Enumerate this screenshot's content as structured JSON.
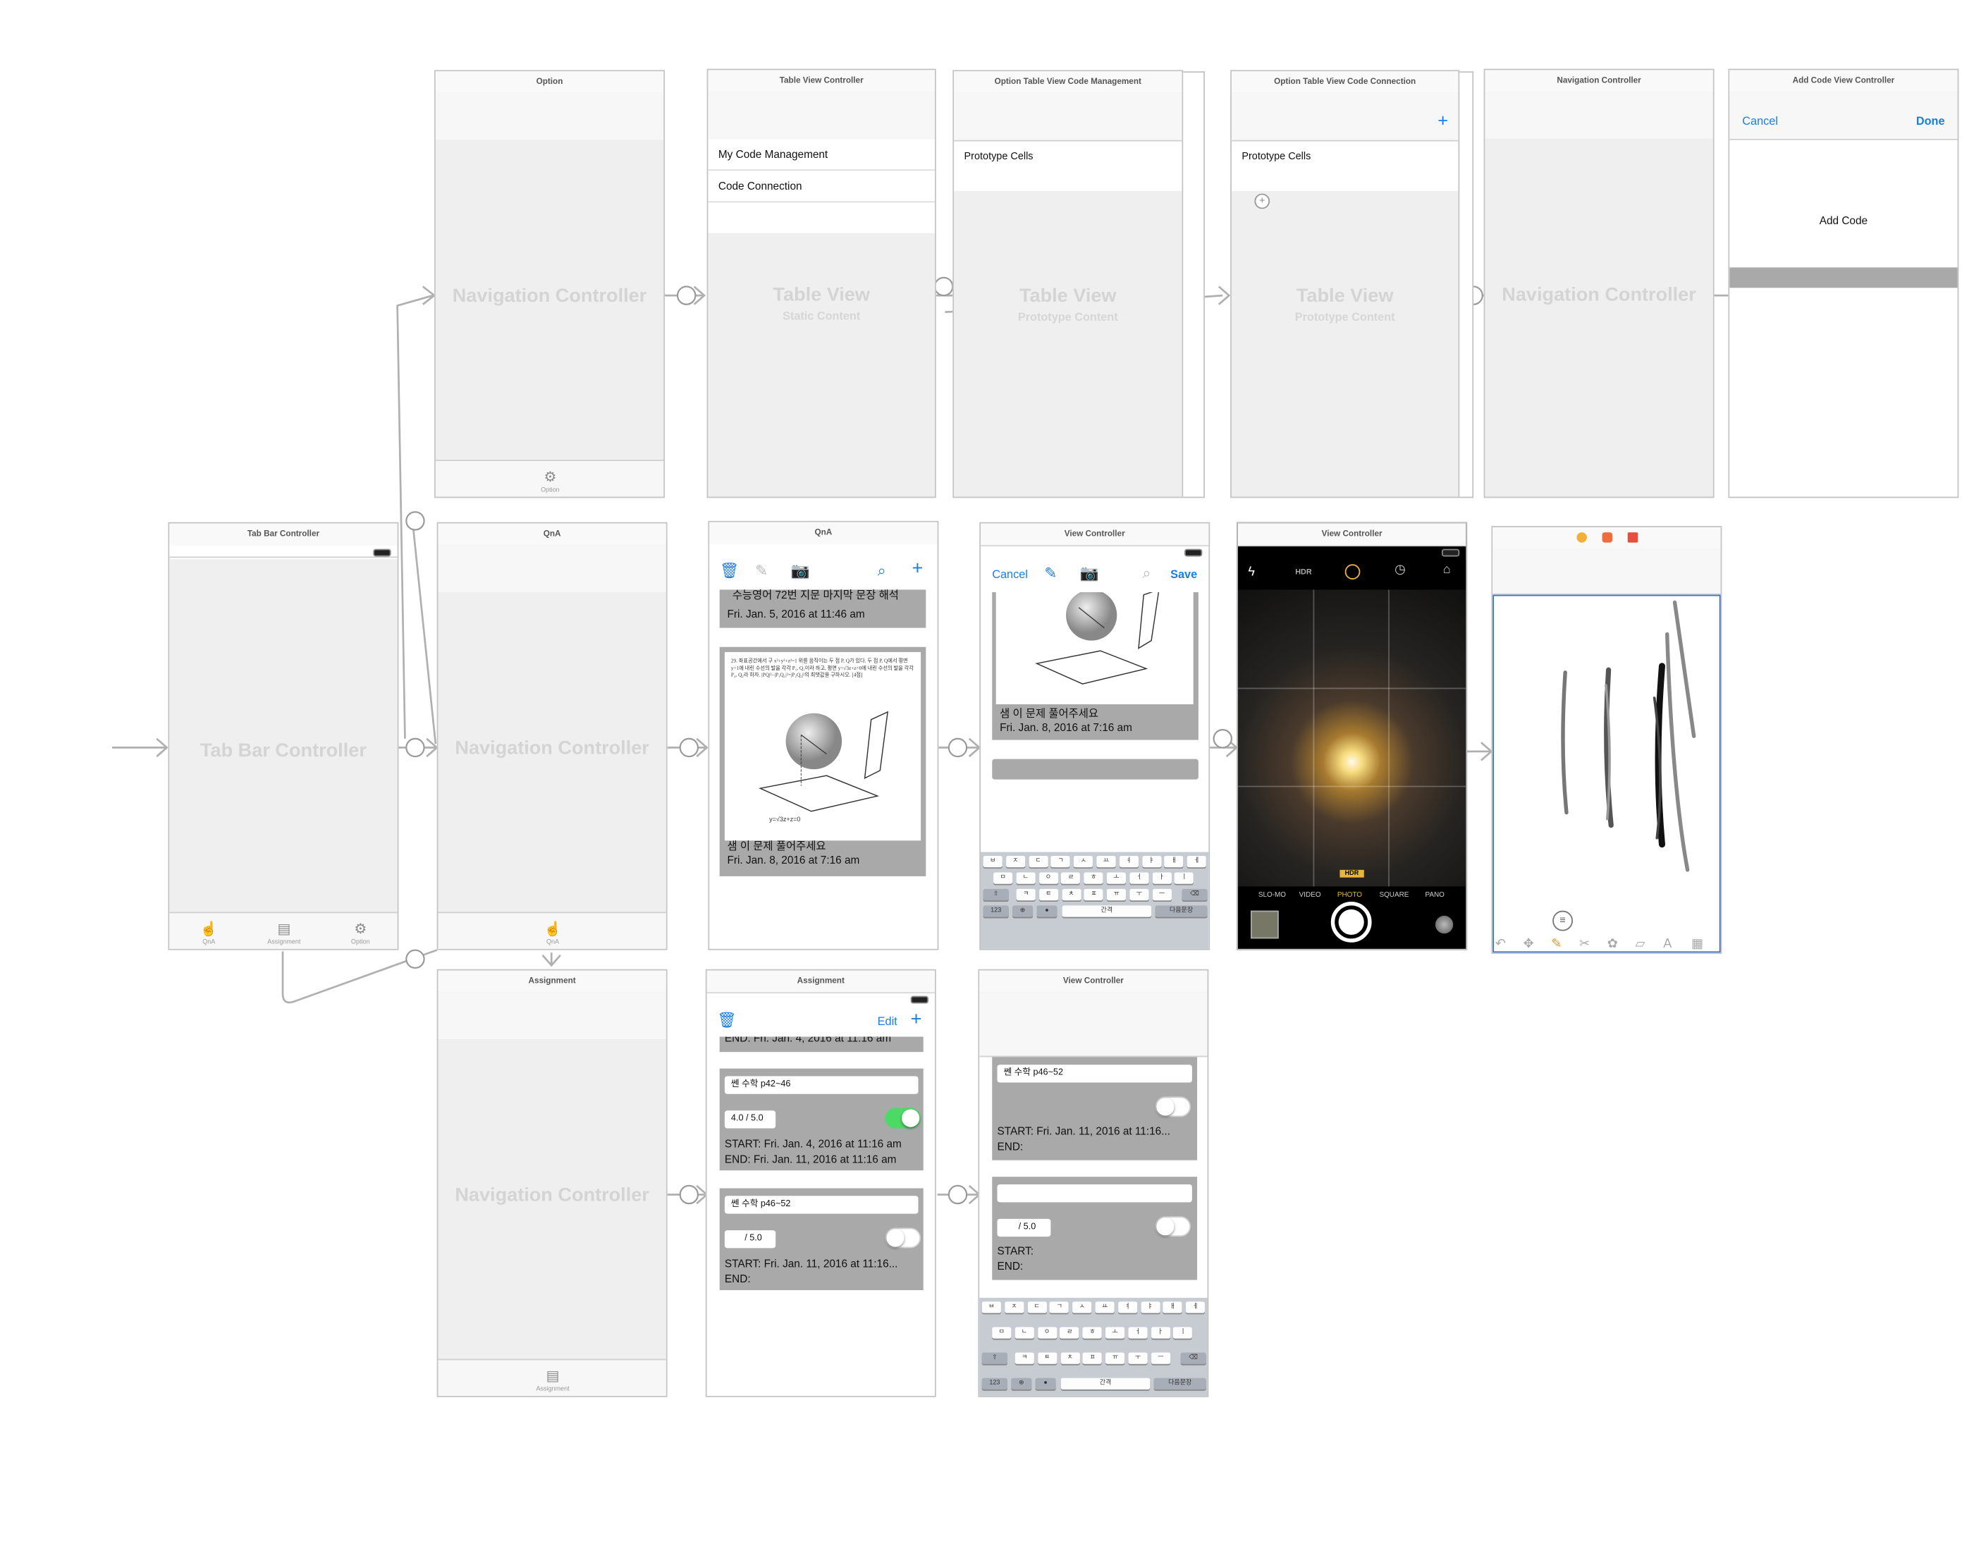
{
  "scenes": {
    "tab_bar": {
      "title": "Tab Bar Controller",
      "watermark": "Tab Bar Controller",
      "tabs": [
        {
          "label": "QnA",
          "icon": "hand-icon"
        },
        {
          "label": "Assignment",
          "icon": "list-icon"
        },
        {
          "label": "Option",
          "icon": "gear-icon"
        }
      ]
    },
    "option_nav": {
      "title": "Option",
      "watermark": "Navigation Controller",
      "tab_label": "Option"
    },
    "qna_nav": {
      "title": "QnA",
      "watermark": "Navigation Controller",
      "tab_label": "QnA"
    },
    "assign_nav": {
      "title": "Assignment",
      "watermark": "Navigation Controller",
      "tab_label": "Assignment"
    },
    "table_vc": {
      "title": "Table View Controller",
      "cells": [
        "My Code Management",
        "Code Connection"
      ],
      "watermark": "Table View",
      "watermark_sub": "Static Content"
    },
    "code_mgmt": {
      "title": "Option Table View Code Management",
      "prototype": "Prototype Cells",
      "watermark": "Table View",
      "watermark_sub": "Prototype Content"
    },
    "code_conn": {
      "title": "Option Table View Code Connection",
      "prototype": "Prototype Cells",
      "watermark": "Table View",
      "watermark_sub": "Prototype Content",
      "add": "+"
    },
    "nav2": {
      "title": "Navigation Controller",
      "watermark": "Navigation Controller"
    },
    "add_code": {
      "title": "Add Code View Controller",
      "cancel": "Cancel",
      "done": "Done",
      "label": "Add Code"
    },
    "qna_list": {
      "title": "QnA",
      "card1_header": "수능영어 72번 지문 마지막 문장 해석",
      "card1_date": "Fri. Jan. 5, 2016 at 11:46 am",
      "card2_caption": "샘 이 문제 풀어주세요",
      "card2_date": "Fri. Jan. 8, 2016 at 7:16 am",
      "problem_text": "29. 좌표공간에서 구 x²+y²+z²=1 위를 움직이는 두 점 P, Q가 있다. 두 점 P, Q에서 평면 y=1에 내린 수선의 발을 각각 P₁, Q₁이라 하고, 평면 y=√3z+z=0에 내린 수선의 발을 각각 P₂, Q₂라 하자. |PQ|²−|P₁Q₁|²=|P₂Q₂|²의 최댓값을 구하시오. [4점]",
      "diagram_label": "y=√3z+z=0"
    },
    "qna_detail": {
      "title": "View Controller",
      "cancel": "Cancel",
      "save": "Save",
      "caption": "샘 이 문제 풀어주세요",
      "date": "Fri. Jan. 8, 2016 at 7:16 am"
    },
    "camera": {
      "title": "View Controller",
      "hdr": "HDR",
      "hdr_badge": "HDR",
      "modes": [
        "SLO-MO",
        "VIDEO",
        "PHOTO",
        "SQUARE",
        "PANO"
      ]
    },
    "drawing": {
      "title": "",
      "toolbar_icons": [
        "undo-icon",
        "pan-icon",
        "pencil-icon",
        "scissors-icon",
        "palette-icon",
        "eraser-icon",
        "text-icon",
        "grid-icon"
      ]
    },
    "assign_list": {
      "title": "Assignment",
      "edit": "Edit",
      "clip_text": "END: Fri. Jan. 4, 2016 at 11:16 am",
      "cards": [
        {
          "name": "쎈 수학 p42~46",
          "score": "4.0 / 5.0",
          "on": true,
          "start": "START: Fri. Jan. 4, 2016 at 11:16 am",
          "end": "END: Fri. Jan. 11, 2016 at 11:16 am"
        },
        {
          "name": "쎈 수학 p46~52",
          "score": "/ 5.0",
          "on": false,
          "start": "START: Fri. Jan. 11, 2016 at 11:16...",
          "end": "END:"
        }
      ]
    },
    "assign_detail": {
      "title": "View Controller",
      "card1": {
        "name": "쎈 수학 p46~52",
        "start": "START: Fri. Jan. 11, 2016 at 11:16...",
        "end": "END:"
      },
      "card2": {
        "name": "",
        "score": "/ 5.0",
        "start": "START:",
        "end": "END:"
      }
    }
  },
  "keyboard": {
    "row1": [
      "ㅂ",
      "ㅈ",
      "ㄷ",
      "ㄱ",
      "ㅅ",
      "ㅛ",
      "ㅕ",
      "ㅑ",
      "ㅐ",
      "ㅔ"
    ],
    "row2": [
      "ㅁ",
      "ㄴ",
      "ㅇ",
      "ㄹ",
      "ㅎ",
      "ㅗ",
      "ㅓ",
      "ㅏ",
      "ㅣ"
    ],
    "row3": [
      "ㅋ",
      "ㅌ",
      "ㅊ",
      "ㅍ",
      "ㅠ",
      "ㅜ",
      "ㅡ"
    ],
    "num": "123",
    "space": "간격",
    "ret": "다음문장"
  },
  "colors": {
    "accent": "#1a7ee2",
    "toggle_on": "#4cd964",
    "card": "#a9a9a9",
    "watermark": "#d4d4d4"
  }
}
